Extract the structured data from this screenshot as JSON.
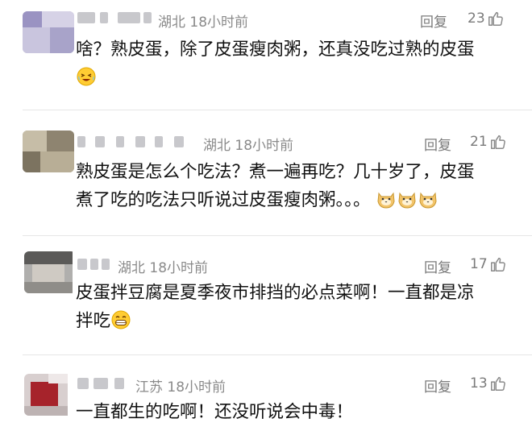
{
  "comments": [
    {
      "location": "湖北",
      "time": "18小时前",
      "reply_label": "回复",
      "likes": "23",
      "lines": [
        "啥？熟皮蛋，除了皮蛋瘦肉粥，还真没吃过熟的皮蛋"
      ],
      "emojis": [
        "laughing-tears"
      ]
    },
    {
      "location": "湖北",
      "time": "18小时前",
      "reply_label": "回复",
      "likes": "21",
      "lines": [
        "熟皮蛋是怎么个吃法？煮一遍再吃？几十岁了，皮蛋",
        "煮了吃的吃法只听说过皮蛋瘦肉粥。。。"
      ],
      "emojis": [
        "doge",
        "doge",
        "doge"
      ]
    },
    {
      "location": "湖北",
      "time": "18小时前",
      "reply_label": "回复",
      "likes": "17",
      "lines": [
        "皮蛋拌豆腐是夏季夜市排挡的必点菜啊！一直都是凉",
        "拌吃"
      ],
      "emojis": [
        "grin"
      ]
    },
    {
      "location": "江苏",
      "time": "18小时前",
      "reply_label": "回复",
      "likes": "13",
      "lines": [
        "一直都生的吃啊！还没听说会中毒！"
      ],
      "emojis": []
    }
  ],
  "colors": {
    "meta_gray": "#8a8a8a",
    "text": "#111111",
    "divider": "#e6e6e6"
  }
}
